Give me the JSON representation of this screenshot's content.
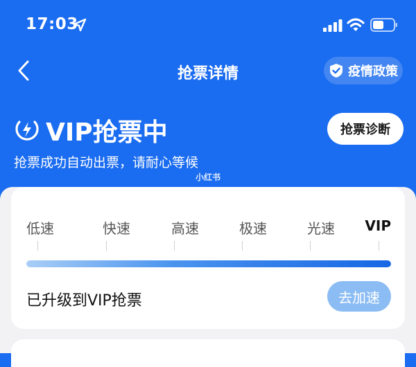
{
  "status_bar": {
    "time": "17:03",
    "icons": [
      "location-arrow-icon",
      "signal-icon",
      "wifi-icon",
      "battery-icon"
    ]
  },
  "nav": {
    "back_icon": "chevron-left-icon",
    "title": "抢票详情",
    "policy_label": "疫情政策",
    "policy_icon": "shield-check-icon"
  },
  "vip": {
    "icon": "lightning-bolt-icon",
    "title": "VIP抢票中",
    "subtitle": "抢票成功自动出票，请耐心等候",
    "diagnose_label": "抢票诊断",
    "watermark": "小红书"
  },
  "speed": {
    "levels": [
      "低速",
      "快速",
      "高速",
      "极速",
      "光速",
      "VIP"
    ],
    "active_level": "VIP",
    "progress_fraction": 1.0,
    "upgrade_text": "已升级到VIP抢票",
    "accelerate_label": "去加速"
  },
  "colors": {
    "header_bg": "#1a6cf0",
    "card_bg": "#ffffff",
    "accelerate_bg": "#8bbcf3"
  }
}
